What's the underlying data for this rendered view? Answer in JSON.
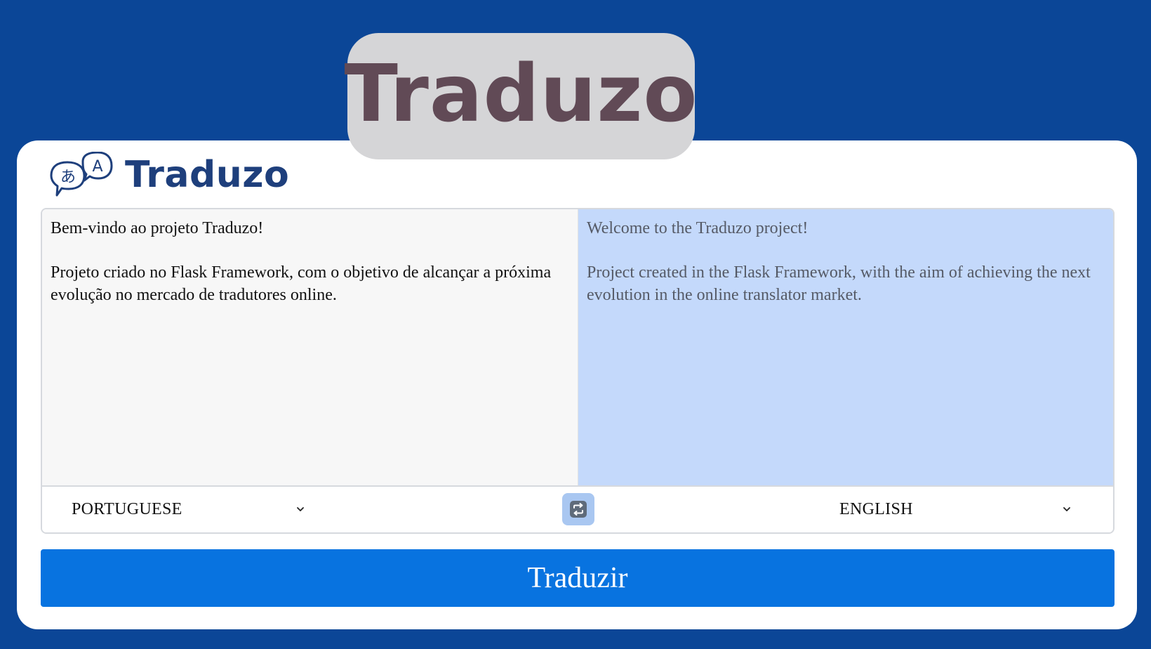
{
  "banner": {
    "title": "Traduzo"
  },
  "header": {
    "brand_name": "Traduzo",
    "logo_glyphs": {
      "left": "あ",
      "right": "A"
    },
    "logo_icon": "translate-speech-bubbles-icon"
  },
  "translator": {
    "source_text": "Bem-vindo ao projeto Traduzo!\n\nProjeto criado no Flask Framework, com o objetivo de alcançar a próxima evolução no mercado de tradutores online.",
    "translated_text": "Welcome to the Traduzo project!\n\nProject created in the Flask Framework, with the aim of achieving the next evolution in the online translator market.",
    "source_language": "PORTUGUESE",
    "target_language": "ENGLISH",
    "swap_icon": "swap-arrows-icon",
    "translate_button_label": "Traduzir"
  },
  "colors": {
    "background": "#0b4697",
    "banner_bg": "#d5d5d7",
    "banner_text": "#614a56",
    "brand_text": "#1e3f7c",
    "source_panel_bg": "#f7f7f7",
    "target_panel_bg": "#c4d9fb",
    "swap_button_bg": "#a9c7f1",
    "primary_button": "#0873e0"
  }
}
